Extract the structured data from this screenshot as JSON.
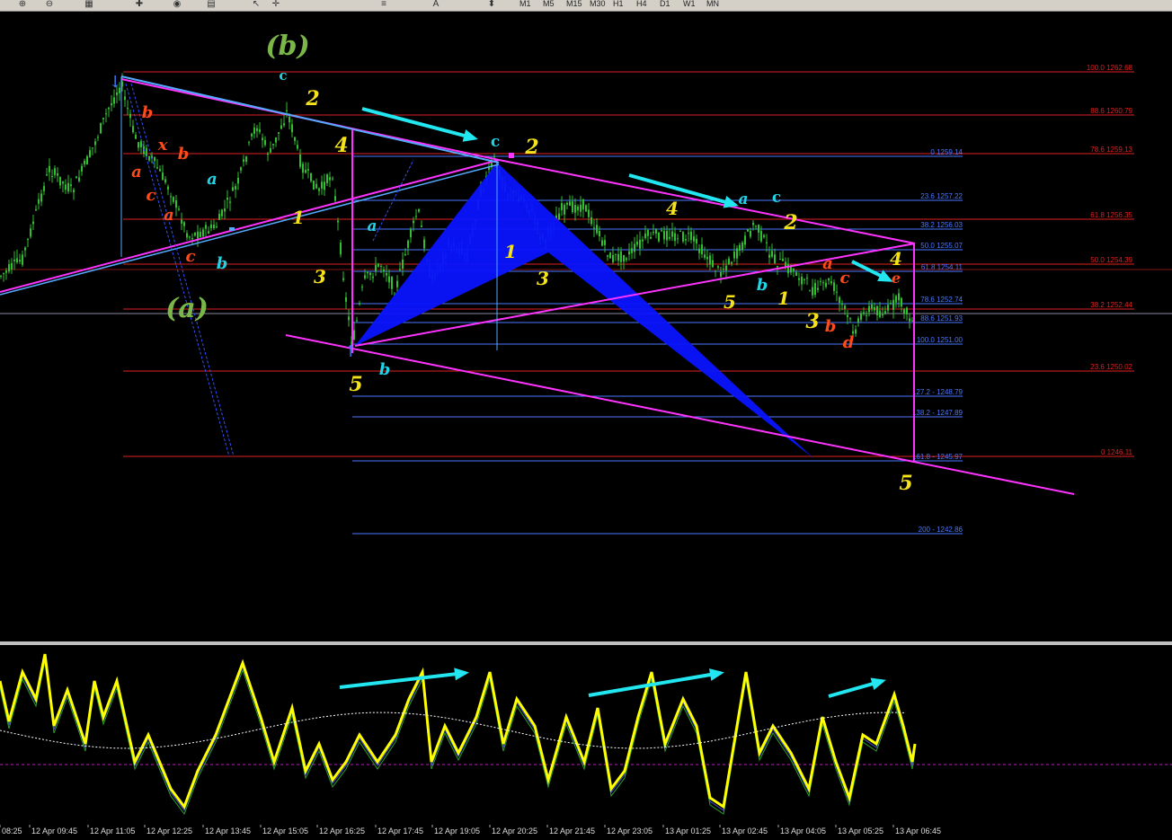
{
  "toolbar": {
    "icons": [
      "zoom-in-icon",
      "zoom-out-icon",
      "grid-icon",
      "new-order-icon",
      "autotrading-icon",
      "chart-icon",
      "cursor-icon",
      "crosshair-icon",
      "fibonacci-icon",
      "text-icon",
      "arrow-icon"
    ],
    "timeframes": [
      "M1",
      "M5",
      "M15",
      "M30",
      "H1",
      "H4",
      "D1",
      "W1",
      "MN"
    ]
  },
  "fib_right": [
    {
      "label": "100.0 1262.68",
      "color": "#e02020"
    },
    {
      "label": "88.6 1260.79",
      "color": "#e02020"
    },
    {
      "label": "78.6 1259.13",
      "color": "#e02020"
    },
    {
      "label": "61.8 1256.35",
      "color": "#e02020"
    },
    {
      "label": "50.0 1254.39",
      "color": "#e02020"
    },
    {
      "label": "38.2 1252.44",
      "color": "#e02020"
    },
    {
      "label": "23.6 1250.02",
      "color": "#e02020"
    },
    {
      "label": "0 1246.11",
      "color": "#e02020"
    }
  ],
  "fib_mid": [
    {
      "label": "0 1259.14",
      "color": "#4a78ff"
    },
    {
      "label": "23.6 1257.22",
      "color": "#4a78ff"
    },
    {
      "label": "38.2 1256.03",
      "color": "#4a78ff"
    },
    {
      "label": "50.0 1255.07",
      "color": "#4a78ff"
    },
    {
      "label": "61.8 1254.11",
      "color": "#4a78ff"
    },
    {
      "label": "78.6 1252.74",
      "color": "#4a78ff"
    },
    {
      "label": "88.6 1251.93",
      "color": "#4a78ff"
    },
    {
      "label": "100.0 1251.00",
      "color": "#4a78ff"
    },
    {
      "label": "127.2 - 1248.79",
      "color": "#4a78ff"
    },
    {
      "label": "138.2 - 1247.89",
      "color": "#4a78ff"
    },
    {
      "label": "161.8 - 1245.97",
      "color": "#4a78ff"
    },
    {
      "label": "200 - 1242.86",
      "color": "#4a78ff"
    }
  ],
  "wave_labels": [
    {
      "text": "(b)",
      "color": "#7ab648"
    },
    {
      "text": "(a)",
      "color": "#7ab648"
    },
    {
      "text": "c",
      "color": "#22d3e6"
    },
    {
      "text": "2",
      "color": "#f5e21a"
    },
    {
      "text": "b",
      "color": "#ff4a1a"
    },
    {
      "text": "x",
      "color": "#ff4a1a"
    },
    {
      "text": "a",
      "color": "#ff4a1a"
    },
    {
      "text": "b",
      "color": "#ff4a1a"
    },
    {
      "text": "c",
      "color": "#ff4a1a"
    },
    {
      "text": "a",
      "color": "#ff4a1a"
    },
    {
      "text": "a",
      "color": "#22d3e6"
    },
    {
      "text": "c",
      "color": "#ff4a1a"
    },
    {
      "text": "b",
      "color": "#22d3e6"
    },
    {
      "text": "4",
      "color": "#f5e21a"
    },
    {
      "text": "1",
      "color": "#f5e21a"
    },
    {
      "text": "3",
      "color": "#f5e21a"
    },
    {
      "text": "5",
      "color": "#f5e21a"
    },
    {
      "text": "b",
      "color": "#22d3e6"
    },
    {
      "text": "a",
      "color": "#22d3e6"
    },
    {
      "text": "c",
      "color": "#22d3e6"
    },
    {
      "text": "2",
      "color": "#f5e21a"
    },
    {
      "text": "1",
      "color": "#f5e21a"
    },
    {
      "text": "3",
      "color": "#f5e21a"
    },
    {
      "text": "4",
      "color": "#f5e21a"
    },
    {
      "text": "a",
      "color": "#22d3e6"
    },
    {
      "text": "c",
      "color": "#22d3e6"
    },
    {
      "text": "2",
      "color": "#f5e21a"
    },
    {
      "text": "5",
      "color": "#f5e21a"
    },
    {
      "text": "b",
      "color": "#22d3e6"
    },
    {
      "text": "1",
      "color": "#f5e21a"
    },
    {
      "text": "a",
      "color": "#ff4a1a"
    },
    {
      "text": "c",
      "color": "#ff4a1a"
    },
    {
      "text": "3",
      "color": "#f5e21a"
    },
    {
      "text": "b",
      "color": "#ff4a1a"
    },
    {
      "text": "d",
      "color": "#ff4a1a"
    },
    {
      "text": "4",
      "color": "#f5e21a"
    },
    {
      "text": "e",
      "color": "#ff4a1a"
    },
    {
      "text": "5",
      "color": "#f5e21a"
    }
  ],
  "time_axis": [
    "08:25",
    "12 Apr 09:45",
    "12 Apr 11:05",
    "12 Apr 12:25",
    "12 Apr 13:45",
    "12 Apr 15:05",
    "12 Apr 16:25",
    "12 Apr 17:45",
    "12 Apr 19:05",
    "12 Apr 20:25",
    "12 Apr 21:45",
    "12 Apr 23:05",
    "13 Apr 01:25",
    "13 Apr 02:45",
    "13 Apr 04:05",
    "13 Apr 05:25",
    "13 Apr 06:45"
  ],
  "colors": {
    "background": "#000000",
    "candles": "#2fbf2f",
    "fib_red": "#e02020",
    "fib_blue": "#4a78ff",
    "trendline": "#ff33ff",
    "pattern_fill": "#0a14ff",
    "arrow": "#22e6f0",
    "oscillator": "#ffff00"
  }
}
